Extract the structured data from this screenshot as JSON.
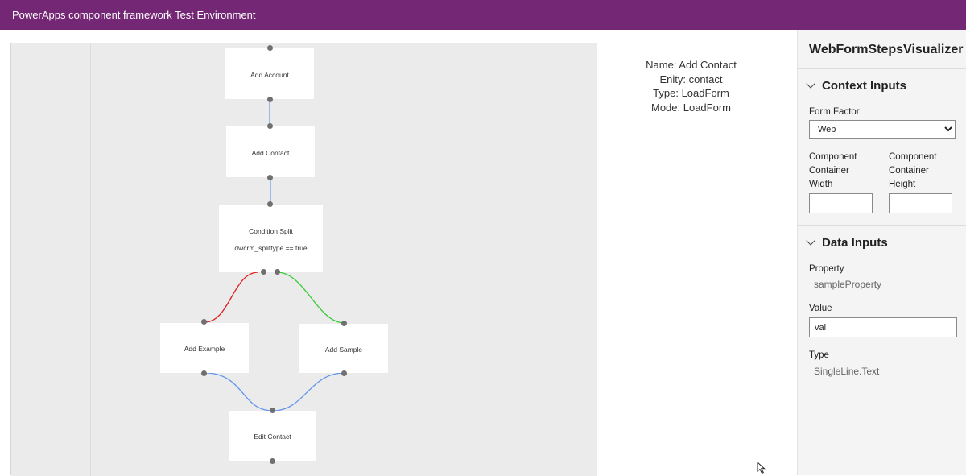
{
  "app": {
    "title": "PowerApps component framework Test Environment"
  },
  "nodes": {
    "add_account": "Add Account",
    "add_contact": "Add Contact",
    "condition_split": "Condition Split",
    "condition_expr": "dwcrm_splittype == true",
    "add_example": "Add Example",
    "add_sample": "Add Sample",
    "edit_contact": "Edit Contact"
  },
  "details": {
    "name": "Name: Add Contact",
    "entity": "Enity: contact",
    "type": "Type: LoadForm",
    "mode": "Mode: LoadForm"
  },
  "colors": {
    "header": "#742774",
    "link_default": "#6495ed",
    "link_false": "#e02020",
    "link_true": "#33cc33"
  },
  "panel": {
    "title": "WebFormStepsVisualizer",
    "context_inputs": {
      "header": "Context Inputs",
      "form_factor_label": "Form Factor",
      "form_factor_value": "Web",
      "form_factor_options": [
        "Web"
      ],
      "width_label": "Component Container Width",
      "width_value": "",
      "height_label": "Component Container Height",
      "height_value": ""
    },
    "data_inputs": {
      "header": "Data Inputs",
      "property_label": "Property",
      "property_value": "sampleProperty",
      "value_label": "Value",
      "value_value": "val",
      "type_label": "Type",
      "type_value": "SingleLine.Text"
    }
  }
}
